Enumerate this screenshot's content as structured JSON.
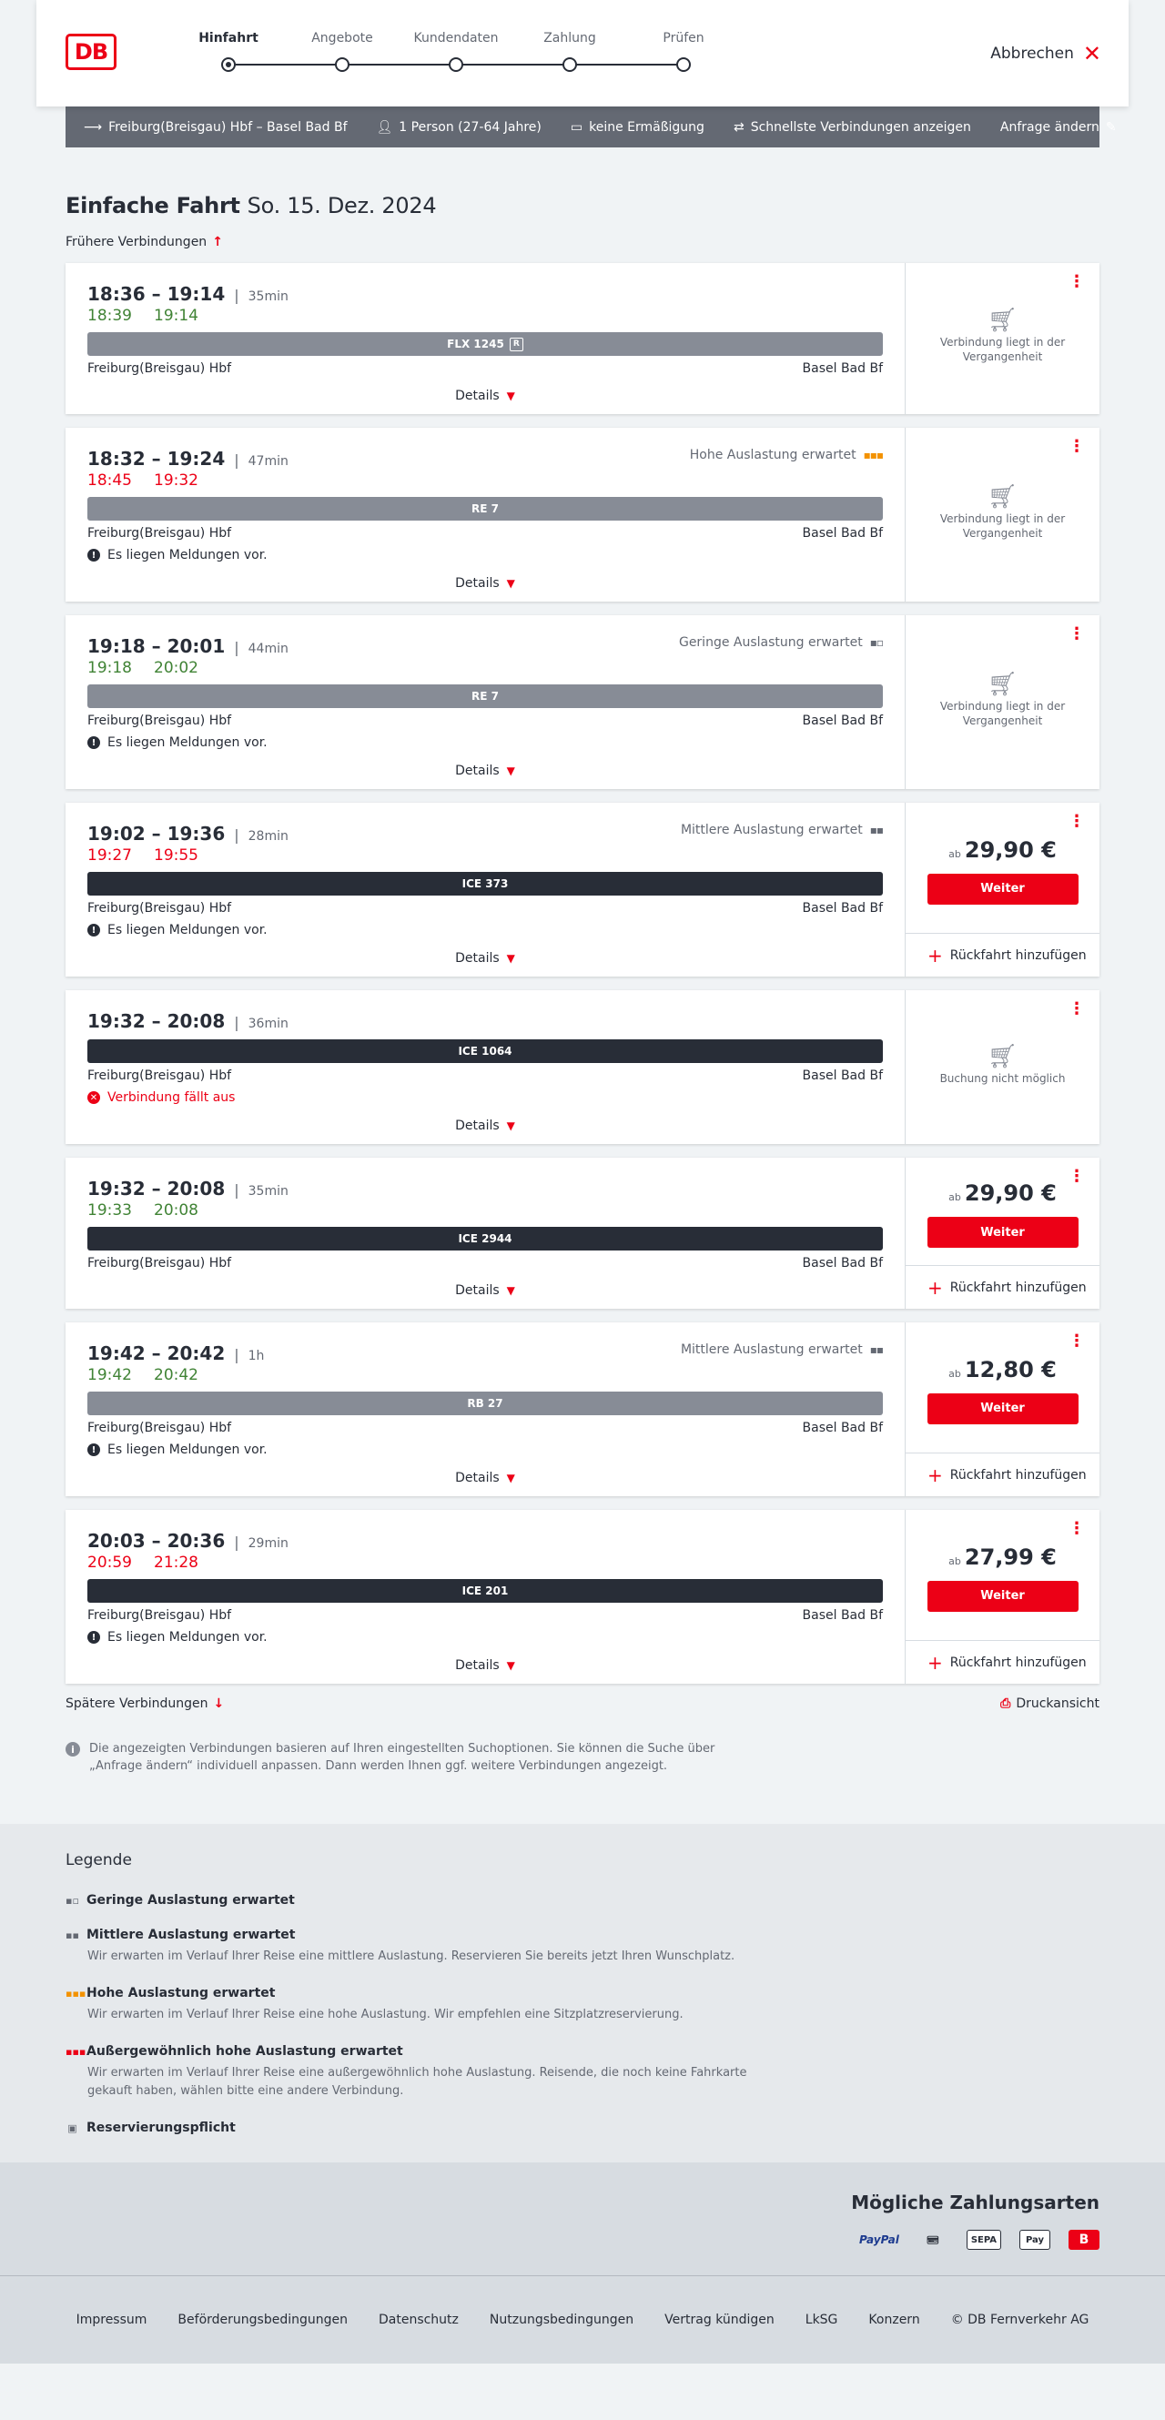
{
  "header": {
    "logo": "DB",
    "steps": [
      {
        "label": "Hinfahrt",
        "active": true
      },
      {
        "label": "Angebote",
        "active": false
      },
      {
        "label": "Kundendaten",
        "active": false
      },
      {
        "label": "Zahlung",
        "active": false
      },
      {
        "label": "Prüfen",
        "active": false
      }
    ],
    "cancel_label": "Abbrechen"
  },
  "summary": {
    "route": "Freiburg(Breisgau) Hbf – Basel Bad Bf",
    "persons": "1 Person (27-64 Jahre)",
    "discount": "keine Ermäßigung",
    "fastest": "Schnellste Verbindungen anzeigen",
    "edit": "Anfrage ändern"
  },
  "page": {
    "title": "Einfache Fahrt",
    "date": "So. 15. Dez. 2024",
    "earlier": "Frühere Verbindungen",
    "later": "Spätere Verbindungen",
    "print": "Druckansicht",
    "info": "Die angezeigten Verbindungen basieren auf Ihren eingestellten Suchoptionen. Sie können die Suche über „Anfrage ändern“ individuell anpassen. Dann werden Ihnen ggf. weitere Verbindungen angezeigt."
  },
  "connections": [
    {
      "times": "18:36 – 19:14",
      "duration": "35min",
      "rt_dep": "18:39",
      "rt_arr": "19:14",
      "rt_class": "green",
      "load": "",
      "train": "FLX 1245",
      "train_style": "grey",
      "reservation": true,
      "from": "Freiburg(Breisgau) Hbf",
      "to": "Basel Bad Bf",
      "message": "",
      "details": "Details",
      "side": "past",
      "side_text": "Verbindung liegt in der Vergangenheit"
    },
    {
      "times": "18:32 – 19:24",
      "duration": "47min",
      "rt_dep": "18:45",
      "rt_arr": "19:32",
      "rt_class": "red",
      "load": "Hohe Auslastung erwartet",
      "train": "RE 7",
      "train_style": "grey",
      "reservation": false,
      "from": "Freiburg(Breisgau) Hbf",
      "to": "Basel Bad Bf",
      "message": "Es liegen Meldungen vor.",
      "details": "Details",
      "side": "past",
      "side_text": "Verbindung liegt in der Vergangenheit"
    },
    {
      "times": "19:18 – 20:01",
      "duration": "44min",
      "rt_dep": "19:18",
      "rt_arr": "20:02",
      "rt_class": "green",
      "load": "Geringe Auslastung erwartet",
      "train": "RE 7",
      "train_style": "grey",
      "reservation": false,
      "from": "Freiburg(Breisgau) Hbf",
      "to": "Basel Bad Bf",
      "message": "Es liegen Meldungen vor.",
      "details": "Details",
      "side": "past",
      "side_text": "Verbindung liegt in der Vergangenheit"
    },
    {
      "times": "19:02 – 19:36",
      "duration": "28min",
      "rt_dep": "19:27",
      "rt_arr": "19:55",
      "rt_class": "red",
      "load": "Mittlere Auslastung erwartet",
      "train": "ICE 373",
      "train_style": "dark",
      "reservation": false,
      "from": "Freiburg(Breisgau) Hbf",
      "to": "Basel Bad Bf",
      "message": "Es liegen Meldungen vor.",
      "details": "Details",
      "side": "price",
      "price_prefix": "ab",
      "price": "29,90 €",
      "button": "Weiter",
      "return_label": "Rückfahrt hinzufügen"
    },
    {
      "times": "19:32 – 20:08",
      "duration": "36min",
      "rt_dep": "",
      "rt_arr": "",
      "rt_class": "none",
      "load": "",
      "train": "ICE 1064",
      "train_style": "dark",
      "reservation": false,
      "from": "Freiburg(Breisgau) Hbf",
      "to": "Basel Bad Bf",
      "message": "Verbindung fällt aus",
      "message_type": "cancelled",
      "details": "Details",
      "side": "blocked",
      "side_text": "Buchung nicht möglich"
    },
    {
      "times": "19:32 – 20:08",
      "duration": "35min",
      "rt_dep": "19:33",
      "rt_arr": "20:08",
      "rt_class": "green",
      "load": "",
      "train": "ICE 2944",
      "train_style": "dark",
      "reservation": false,
      "from": "Freiburg(Breisgau) Hbf",
      "to": "Basel Bad Bf",
      "message": "",
      "details": "Details",
      "side": "price",
      "price_prefix": "ab",
      "price": "29,90 €",
      "button": "Weiter",
      "return_label": "Rückfahrt hinzufügen"
    },
    {
      "times": "19:42 – 20:42",
      "duration": "1h",
      "rt_dep": "19:42",
      "rt_arr": "20:42",
      "rt_class": "green",
      "load": "Mittlere Auslastung erwartet",
      "train": "RB 27",
      "train_style": "grey",
      "reservation": false,
      "from": "Freiburg(Breisgau) Hbf",
      "to": "Basel Bad Bf",
      "message": "Es liegen Meldungen vor.",
      "details": "Details",
      "side": "price",
      "price_prefix": "ab",
      "price": "12,80 €",
      "button": "Weiter",
      "return_label": "Rückfahrt hinzufügen"
    },
    {
      "times": "20:03 – 20:36",
      "duration": "29min",
      "rt_dep": "20:59",
      "rt_arr": "21:28",
      "rt_class": "red",
      "load": "",
      "train": "ICE 201",
      "train_style": "dark",
      "reservation": false,
      "from": "Freiburg(Breisgau) Hbf",
      "to": "Basel Bad Bf",
      "message": "Es liegen Meldungen vor.",
      "details": "Details",
      "side": "price",
      "price_prefix": "ab",
      "price": "27,99 €",
      "button": "Weiter",
      "return_label": "Rückfahrt hinzufügen"
    }
  ],
  "legend": {
    "title": "Legende",
    "items": [
      {
        "title": "Geringe Auslastung erwartet",
        "desc": "",
        "icon": "low-load-icon"
      },
      {
        "title": "Mittlere Auslastung erwartet",
        "desc": "Wir erwarten im Verlauf Ihrer Reise eine mittlere Auslastung. Reservieren Sie bereits jetzt Ihren Wunschplatz.",
        "icon": "medium-load-icon"
      },
      {
        "title": "Hohe Auslastung erwartet",
        "desc": "Wir erwarten im Verlauf Ihrer Reise eine hohe Auslastung. Wir empfehlen eine Sitzplatzreservierung.",
        "icon": "high-load-icon"
      },
      {
        "title": "Außergewöhnlich hohe Auslastung erwartet",
        "desc": "Wir erwarten im Verlauf Ihrer Reise eine außergewöhnlich hohe Auslastung. Reisende, die noch keine Fahrkarte gekauft haben, wählen bitte eine andere Verbindung.",
        "icon": "extreme-load-icon"
      },
      {
        "title": "Reservierungspflicht",
        "desc": "",
        "icon": "reservation-icon"
      }
    ]
  },
  "payments": {
    "title": "Mögliche Zahlungsarten",
    "methods": [
      "PayPal",
      "Kreditkarte",
      "SEPA",
      "Apple Pay",
      "DB"
    ]
  },
  "footer": {
    "links": [
      "Impressum",
      "Beförderungsbedingungen",
      "Datenschutz",
      "Nutzungsbedingungen",
      "Vertrag kündigen",
      "LkSG",
      "Konzern",
      "© DB Fernverkehr AG"
    ]
  },
  "colors": {
    "accent": "#ec0016",
    "on_time": "#408335",
    "summary_bar": "#646973",
    "train_dark": "#282d37",
    "train_grey": "#878c96"
  }
}
